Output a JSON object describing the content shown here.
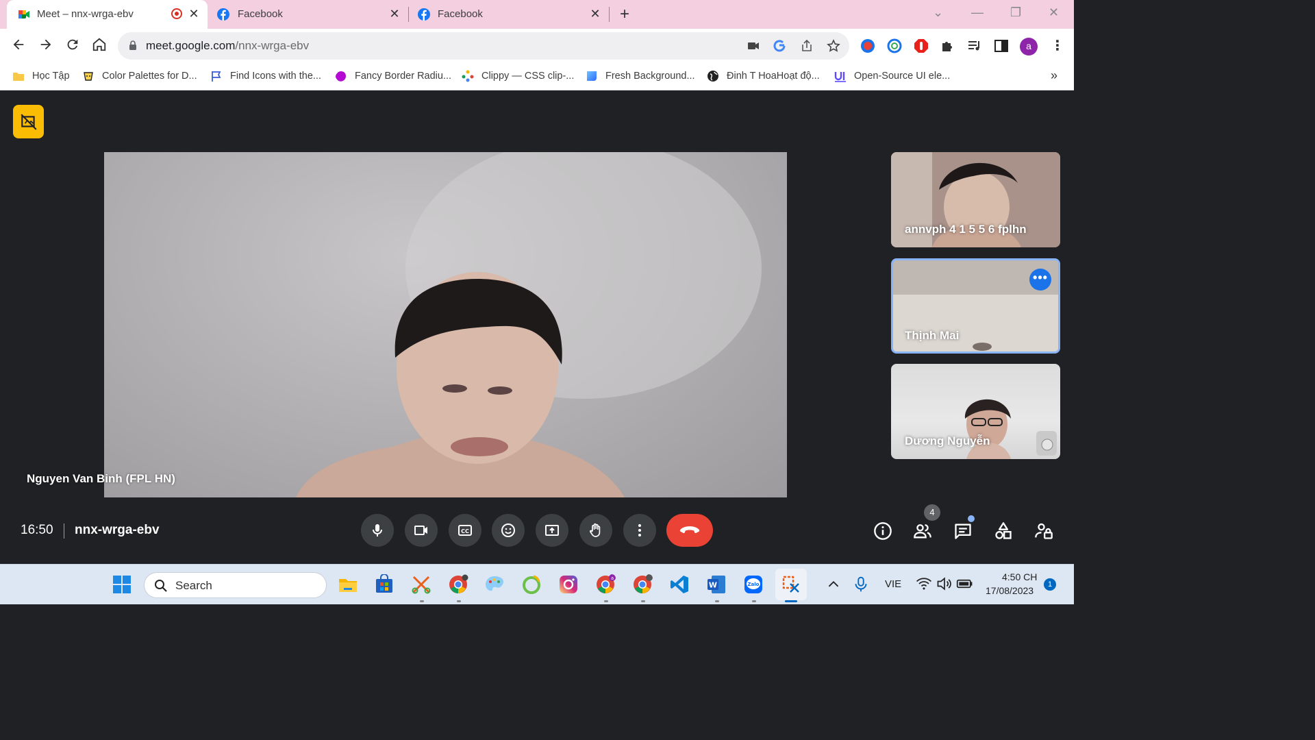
{
  "browser": {
    "tabs": [
      {
        "title": "Meet – nnx-wrga-ebv",
        "active": true,
        "icon": "google-meet-icon",
        "recording": true
      },
      {
        "title": "Facebook",
        "active": false,
        "icon": "facebook-icon"
      },
      {
        "title": "Facebook",
        "active": false,
        "icon": "facebook-icon"
      }
    ],
    "address": {
      "host": "meet.google.com",
      "path": "/nnx-wrga-ebv"
    },
    "bookmarks": [
      {
        "label": "Học Tập",
        "icon": "folder-icon"
      },
      {
        "label": "Color Palettes for D...",
        "icon": "palette-icon"
      },
      {
        "label": "Find Icons with the...",
        "icon": "flag-icon"
      },
      {
        "label": "Fancy Border Radiu...",
        "icon": "blob-icon"
      },
      {
        "label": "Clippy — CSS clip-...",
        "icon": "dots-icon"
      },
      {
        "label": "Fresh Background...",
        "icon": "gradient-icon"
      },
      {
        "label": "Đinh T HoaHoạt độ...",
        "icon": "globe-icon"
      },
      {
        "label": "Open-Source UI ele...",
        "icon": "ui-icon"
      }
    ],
    "profile_initial": "a",
    "colors": {
      "tabstrip": "#f3cfe0",
      "accent": "#1a73e8",
      "hangup": "#ea4335"
    }
  },
  "meet": {
    "main_participant": "Nguyen Van Binh (FPL HN)",
    "tiles": [
      {
        "name": "annvph 4 1 5 5 6 fplhn"
      },
      {
        "name": "Thịnh Mai",
        "highlighted": true
      },
      {
        "name": "Dương Nguyễn"
      }
    ],
    "time": "16:50",
    "meeting_code": "nnx-wrga-ebv",
    "controls": [
      "microphone",
      "camera",
      "captions",
      "reactions",
      "present",
      "raise-hand",
      "more-options",
      "leave-call"
    ],
    "right_controls": [
      "meeting-details",
      "people",
      "chat",
      "activities",
      "host-controls"
    ],
    "people_count": "4"
  },
  "taskbar": {
    "search_placeholder": "Search",
    "language": "VIE",
    "time": "4:50 CH",
    "date": "17/08/2023",
    "notifications": "1"
  }
}
